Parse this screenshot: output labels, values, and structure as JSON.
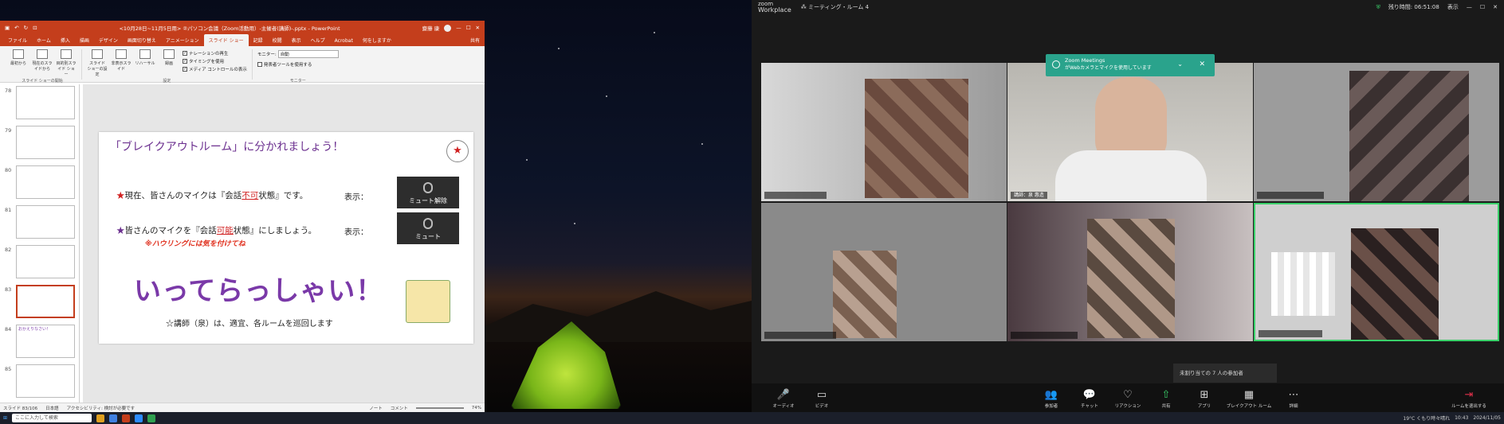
{
  "ppt": {
    "title": "<10月28日~11月5日用> ②パソコン会議（Zoom活動用）-主催者(講師)-.pptx - PowerPoint",
    "user": "齋藤  康",
    "tabs": [
      "ファイル",
      "ホーム",
      "挿入",
      "描画",
      "デザイン",
      "画面切り替え",
      "アニメーション",
      "スライド ショー",
      "記録",
      "校閲",
      "表示",
      "ヘルプ",
      "Acrobat",
      "何をしますか"
    ],
    "active_tab": "スライド ショー",
    "share_label": "共有",
    "ribbon": {
      "buttons": [
        "最初から",
        "現在のスライドから",
        "目的別スライド ショー",
        "スライド ショーの設定",
        "非表示スライド",
        "リハーサル",
        "録画"
      ],
      "group_start": "スライド ショーの開始",
      "group_setup": "設定",
      "group_monitor": "モニター",
      "checks": [
        "ナレーションの再生",
        "タイミングを使用",
        "メディア コントロールの表示"
      ],
      "monitor_label": "モニター:",
      "monitor_value": "自動",
      "presenter_tool": "発表者ツールを使用する"
    },
    "thumbnail_numbers": [
      "78",
      "79",
      "80",
      "81",
      "82",
      "83",
      "84",
      "85"
    ],
    "thumb_84_title": "おかえりなさい！",
    "slide": {
      "heading": "「ブレイクアウトルーム」に分かれましょう！",
      "star_mark": "★",
      "line1": [
        "★",
        "現在、皆さんのマイクは『会話",
        "不可",
        "状態』です。"
      ],
      "line2": [
        "★",
        "皆さんのマイクを『会話",
        "可能",
        "状態』にしましょう。"
      ],
      "display_label": "表示：",
      "warning": "※ハウリングには気を付けてね",
      "big_text": "いってらっしゃい！",
      "footer": "☆講師（泉）は、適宜、各ルームを巡回します",
      "btn_unmute": "ミュート解除",
      "btn_mute": "ミュート"
    },
    "status": {
      "slide_pos": "スライド 83/106",
      "lang": "日本語",
      "access": "アクセシビリティ: 検討が必要です",
      "notes": "ノート",
      "comments": "コメント",
      "zoom": "74%"
    }
  },
  "zoom": {
    "brand_top": "zoom",
    "brand": "Workplace",
    "room": "ミーティング・ルーム 4",
    "timer": "残り時間: 06:51:08",
    "view": "表示",
    "notification": {
      "title": "Zoom Meetings",
      "body": "がWebカメラとマイクを使用しています"
    },
    "instructor_label": "講師：泉 惠造",
    "toast": "未割り当ての 7 人の参加者",
    "toolbar": [
      "オーディオ",
      "ビデオ",
      "参加者",
      "チャット",
      "リアクション",
      "共有",
      "アプリ",
      "ブレイクアウト ルーム",
      "詳細",
      "ルームを退出する"
    ],
    "participants_count": "6",
    "colors": {
      "notif": "#2aa38c",
      "share": "#3ad06a",
      "mute": "#e0304a",
      "active_border": "#3ad06a"
    }
  },
  "taskbar": {
    "search": "ここに入力して検索",
    "time_left": "10:43",
    "date_left": "2024/11/05",
    "weather": "19°C くもり時々晴れ",
    "time_right": "10:43",
    "date_right": "2024/11/05"
  }
}
